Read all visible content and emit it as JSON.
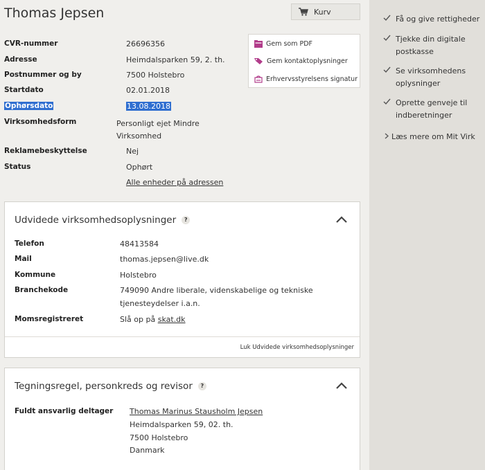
{
  "company": {
    "name": "Thomas Jepsen"
  },
  "basket": {
    "label": "Kurv"
  },
  "facts": [
    {
      "label": "CVR-nummer",
      "value": "26696356"
    },
    {
      "label": "Adresse",
      "value": "Heimdalsparken 59, 2. th."
    },
    {
      "label": "Postnummer og by",
      "value": "7500 Holstebro"
    },
    {
      "label": "Startdato",
      "value": "02.01.2018"
    },
    {
      "label": "Ophørsdato",
      "value": "13.08.2018"
    },
    {
      "label": "Virksomhedsform",
      "value_line1": "Personligt ejet Mindre",
      "value_line2": "Virksomhed"
    },
    {
      "label": "Reklamebeskyttelse",
      "value": "Nej"
    },
    {
      "label": "Status",
      "value": "Ophørt"
    }
  ],
  "all_units_link": "Alle enheder på adressen",
  "actions": [
    {
      "label": "Gem som PDF",
      "icon": "pdf-folder-icon"
    },
    {
      "label": "Gem kontaktoplysninger",
      "icon": "tag-icon"
    },
    {
      "label": "Erhvervsstyrelsens signatur",
      "icon": "signature-icon"
    }
  ],
  "extended": {
    "title": "Udvidede virksomhedsoplysninger",
    "help": "?",
    "rows": [
      {
        "label": "Telefon",
        "value": "48413584"
      },
      {
        "label": "Mail",
        "value": "thomas.jepsen@live.dk"
      },
      {
        "label": "Kommune",
        "value": "Holstebro"
      },
      {
        "label": "Branchekode",
        "value_line1": "749090 Andre liberale, videnskabelige og tekniske",
        "value_line2": "tjenesteydelser i.a.n."
      },
      {
        "label": "Momsregistreret",
        "value_prefix": "Slå op på ",
        "value_link": "skat.dk"
      }
    ],
    "close_label": "Luk Udvidede virksomhedsoplysninger"
  },
  "signing": {
    "title": "Tegningsregel, personkreds og revisor",
    "help": "?",
    "label": "Fuldt ansvarlig deltager",
    "person_link": "Thomas Marinus Stausholm Jepsen",
    "address_line1": "Heimdalsparken 59, 02. th.",
    "address_line2": "7500 Holstebro",
    "address_line3": "Danmark"
  },
  "sidebar": {
    "items": [
      {
        "line1": "Få og give rettigheder"
      },
      {
        "line1": "Tjekke din digitale",
        "line2": "postkasse"
      },
      {
        "line1": "Se virksomhedens",
        "line2": "oplysninger"
      },
      {
        "line1": "Oprette genveje til",
        "line2": "indberetninger"
      }
    ],
    "more_link": "Læs mere om Mit Virk"
  }
}
